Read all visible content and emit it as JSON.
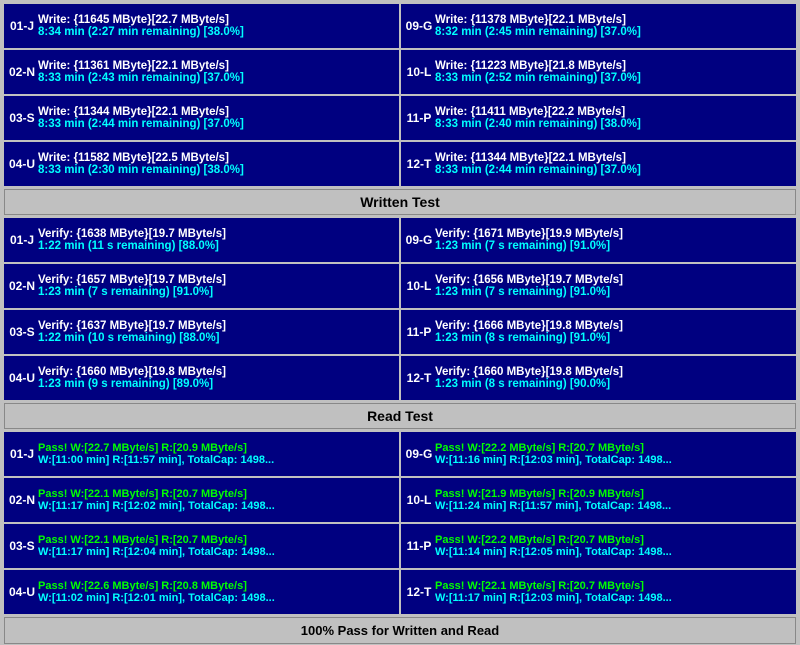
{
  "headers": {
    "written_test": "Written Test",
    "read_test": "Read Test",
    "footer": "100% Pass for Written and Read"
  },
  "write_section": {
    "left": [
      {
        "id": "01-J",
        "line1": "Write: {11645 MByte}[22.7 MByte/s]",
        "line2": "8:34 min (2:27 min remaining)  [38.0%]"
      },
      {
        "id": "02-N",
        "line1": "Write: {11361 MByte}[22.1 MByte/s]",
        "line2": "8:33 min (2:43 min remaining)  [37.0%]"
      },
      {
        "id": "03-S",
        "line1": "Write: {11344 MByte}[22.1 MByte/s]",
        "line2": "8:33 min (2:44 min remaining)  [37.0%]"
      },
      {
        "id": "04-U",
        "line1": "Write: {11582 MByte}[22.5 MByte/s]",
        "line2": "8:33 min (2:30 min remaining)  [38.0%]"
      }
    ],
    "right": [
      {
        "id": "09-G",
        "line1": "Write: {11378 MByte}[22.1 MByte/s]",
        "line2": "8:32 min (2:45 min remaining)  [37.0%]"
      },
      {
        "id": "10-L",
        "line1": "Write: {11223 MByte}[21.8 MByte/s]",
        "line2": "8:33 min (2:52 min remaining)  [37.0%]"
      },
      {
        "id": "11-P",
        "line1": "Write: {11411 MByte}[22.2 MByte/s]",
        "line2": "8:33 min (2:40 min remaining)  [38.0%]"
      },
      {
        "id": "12-T",
        "line1": "Write: {11344 MByte}[22.1 MByte/s]",
        "line2": "8:33 min (2:44 min remaining)  [37.0%]"
      }
    ]
  },
  "verify_section": {
    "left": [
      {
        "id": "01-J",
        "line1": "Verify: {1638 MByte}[19.7 MByte/s]",
        "line2": "1:22 min (11 s remaining)   [88.0%]"
      },
      {
        "id": "02-N",
        "line1": "Verify: {1657 MByte}[19.7 MByte/s]",
        "line2": "1:23 min (7 s remaining)   [91.0%]"
      },
      {
        "id": "03-S",
        "line1": "Verify: {1637 MByte}[19.7 MByte/s]",
        "line2": "1:22 min (10 s remaining)   [88.0%]"
      },
      {
        "id": "04-U",
        "line1": "Verify: {1660 MByte}[19.8 MByte/s]",
        "line2": "1:23 min (9 s remaining)   [89.0%]"
      }
    ],
    "right": [
      {
        "id": "09-G",
        "line1": "Verify: {1671 MByte}[19.9 MByte/s]",
        "line2": "1:23 min (7 s remaining)   [91.0%]"
      },
      {
        "id": "10-L",
        "line1": "Verify: {1656 MByte}[19.7 MByte/s]",
        "line2": "1:23 min (7 s remaining)   [91.0%]"
      },
      {
        "id": "11-P",
        "line1": "Verify: {1666 MByte}[19.8 MByte/s]",
        "line2": "1:23 min (8 s remaining)   [91.0%]"
      },
      {
        "id": "12-T",
        "line1": "Verify: {1660 MByte}[19.8 MByte/s]",
        "line2": "1:23 min (8 s remaining)   [90.0%]"
      }
    ]
  },
  "pass_section": {
    "left": [
      {
        "id": "01-J",
        "line1": "Pass! W:[22.7 MByte/s] R:[20.9 MByte/s]",
        "line2": "W:[11:00 min] R:[11:57 min], TotalCap: 1498..."
      },
      {
        "id": "02-N",
        "line1": "Pass! W:[22.1 MByte/s] R:[20.7 MByte/s]",
        "line2": "W:[11:17 min] R:[12:02 min], TotalCap: 1498..."
      },
      {
        "id": "03-S",
        "line1": "Pass! W:[22.1 MByte/s] R:[20.7 MByte/s]",
        "line2": "W:[11:17 min] R:[12:04 min], TotalCap: 1498..."
      },
      {
        "id": "04-U",
        "line1": "Pass! W:[22.6 MByte/s] R:[20.8 MByte/s]",
        "line2": "W:[11:02 min] R:[12:01 min], TotalCap: 1498..."
      }
    ],
    "right": [
      {
        "id": "09-G",
        "line1": "Pass! W:[22.2 MByte/s] R:[20.7 MByte/s]",
        "line2": "W:[11:16 min] R:[12:03 min], TotalCap: 1498..."
      },
      {
        "id": "10-L",
        "line1": "Pass! W:[21.9 MByte/s] R:[20.9 MByte/s]",
        "line2": "W:[11:24 min] R:[11:57 min], TotalCap: 1498..."
      },
      {
        "id": "11-P",
        "line1": "Pass! W:[22.2 MByte/s] R:[20.7 MByte/s]",
        "line2": "W:[11:14 min] R:[12:05 min], TotalCap: 1498..."
      },
      {
        "id": "12-T",
        "line1": "Pass! W:[22.1 MByte/s] R:[20.7 MByte/s]",
        "line2": "W:[11:17 min] R:[12:03 min], TotalCap: 1498..."
      }
    ]
  }
}
